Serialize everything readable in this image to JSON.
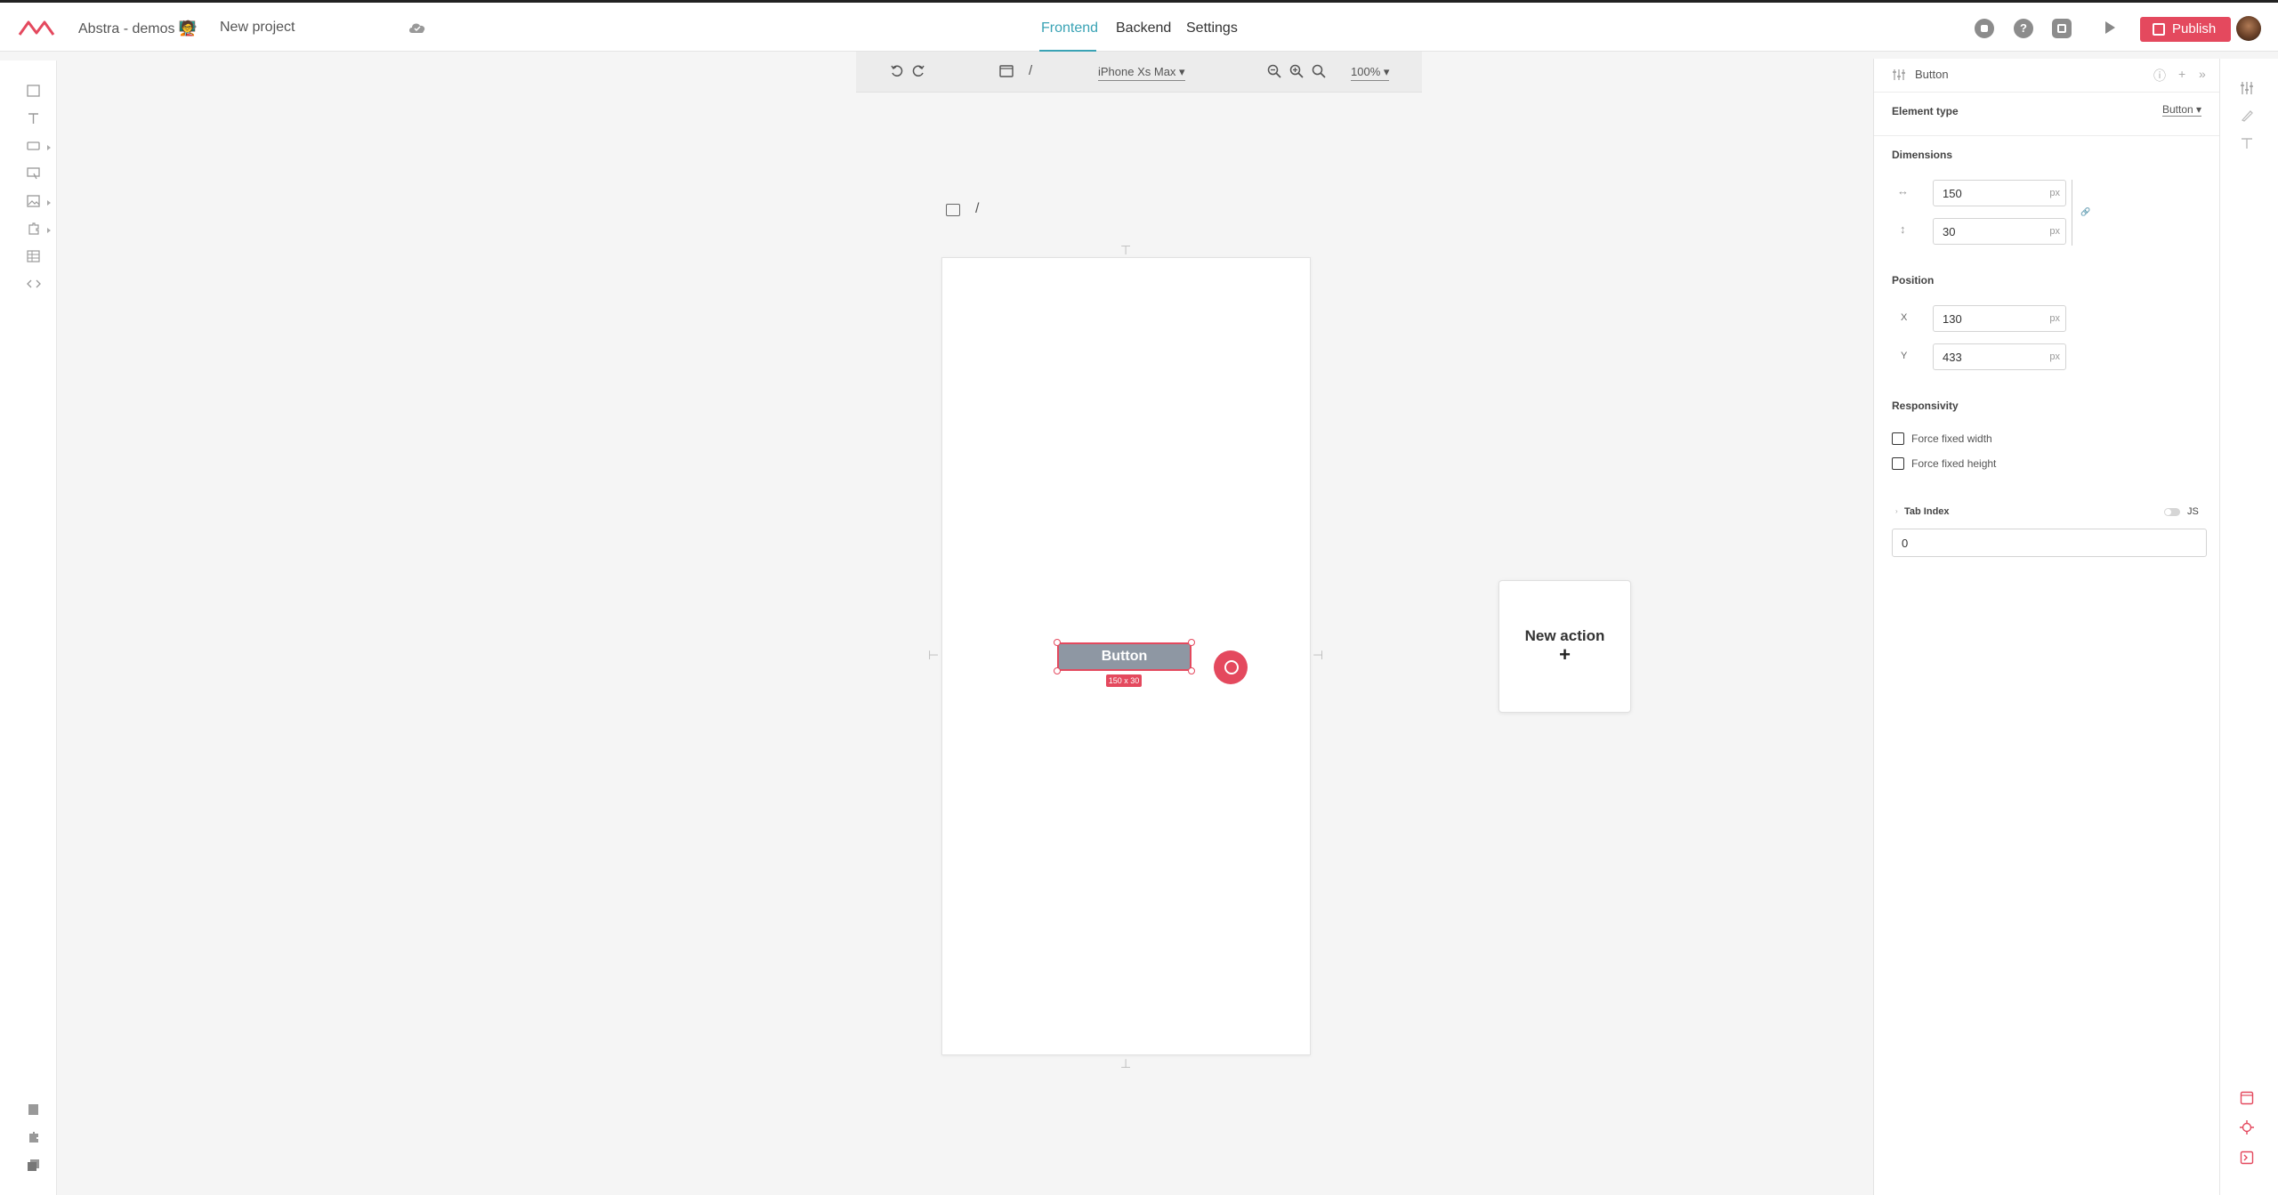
{
  "header": {
    "workspace": "Abstra - demos 🧑‍🏫",
    "project": "New project",
    "tabs": [
      {
        "label": "Frontend",
        "active": true
      },
      {
        "label": "Backend",
        "active": false
      },
      {
        "label": "Settings",
        "active": false
      }
    ],
    "help_glyph": "?",
    "publish_label": "Publish"
  },
  "canvas_toolbar": {
    "path_sep": "/",
    "device": "iPhone Xs Max ▾",
    "zoom": "100% ▾"
  },
  "canvas": {
    "page_path": "/",
    "button_label": "Button",
    "size_badge": "150 x 30"
  },
  "new_action": {
    "label": "New action",
    "plus": "+"
  },
  "properties": {
    "title": "Button",
    "element_type_label": "Element type",
    "element_type_value": "Button ▾",
    "dimensions_label": "Dimensions",
    "width": "150",
    "height": "30",
    "unit": "px",
    "position_label": "Position",
    "x_label": "X",
    "y_label": "Y",
    "x": "130",
    "y": "433",
    "responsivity_label": "Responsivity",
    "force_fixed_width": "Force fixed width",
    "force_fixed_height": "Force fixed height",
    "tab_index_label": "Tab Index",
    "js_label": "JS",
    "tab_index_value": "0"
  },
  "colors": {
    "accent": "#3aa3b5",
    "brand": "#e4495e",
    "button_fill": "#8e97a3"
  }
}
